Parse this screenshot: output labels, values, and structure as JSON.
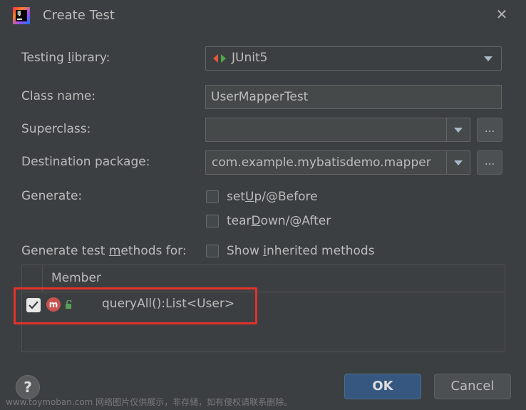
{
  "window": {
    "title": "Create Test",
    "close_icon": "close-icon"
  },
  "testing_library": {
    "label_pre": "Testing ",
    "label_u": "l",
    "label_post": "ibrary:",
    "value": "JUnit5"
  },
  "class_name": {
    "label": "Class name:",
    "value": "UserMapperTest"
  },
  "superclass": {
    "label": "Superclass:",
    "value": "",
    "browse": "..."
  },
  "destination_package": {
    "label": "Destination package:",
    "value": "com.example.mybatisdemo.mapper",
    "browse": "..."
  },
  "generate": {
    "label": "Generate:",
    "setup": {
      "pre": "set",
      "u": "U",
      "post": "p/@Before",
      "checked": false
    },
    "teardown": {
      "pre": "tear",
      "u": "D",
      "post": "own/@After",
      "checked": false
    }
  },
  "methods_for": {
    "label_pre": "Generate test ",
    "label_u": "m",
    "label_post": "ethods for:",
    "show_inherited": {
      "pre": "Show ",
      "u": "i",
      "post": "nherited methods",
      "checked": false
    }
  },
  "table": {
    "header": "Member",
    "rows": [
      {
        "checked": true,
        "icon": "m",
        "text": "queryAll():List<User>"
      }
    ]
  },
  "buttons": {
    "ok": "OK",
    "cancel": "Cancel",
    "help": "?"
  },
  "watermark": "www.toymoban.com 网络图片仅供展示，非存储，如有侵权请联系删除。",
  "colors": {
    "background": "#3c3f41",
    "highlight": "#e3312b",
    "ok_button": "#365880"
  }
}
